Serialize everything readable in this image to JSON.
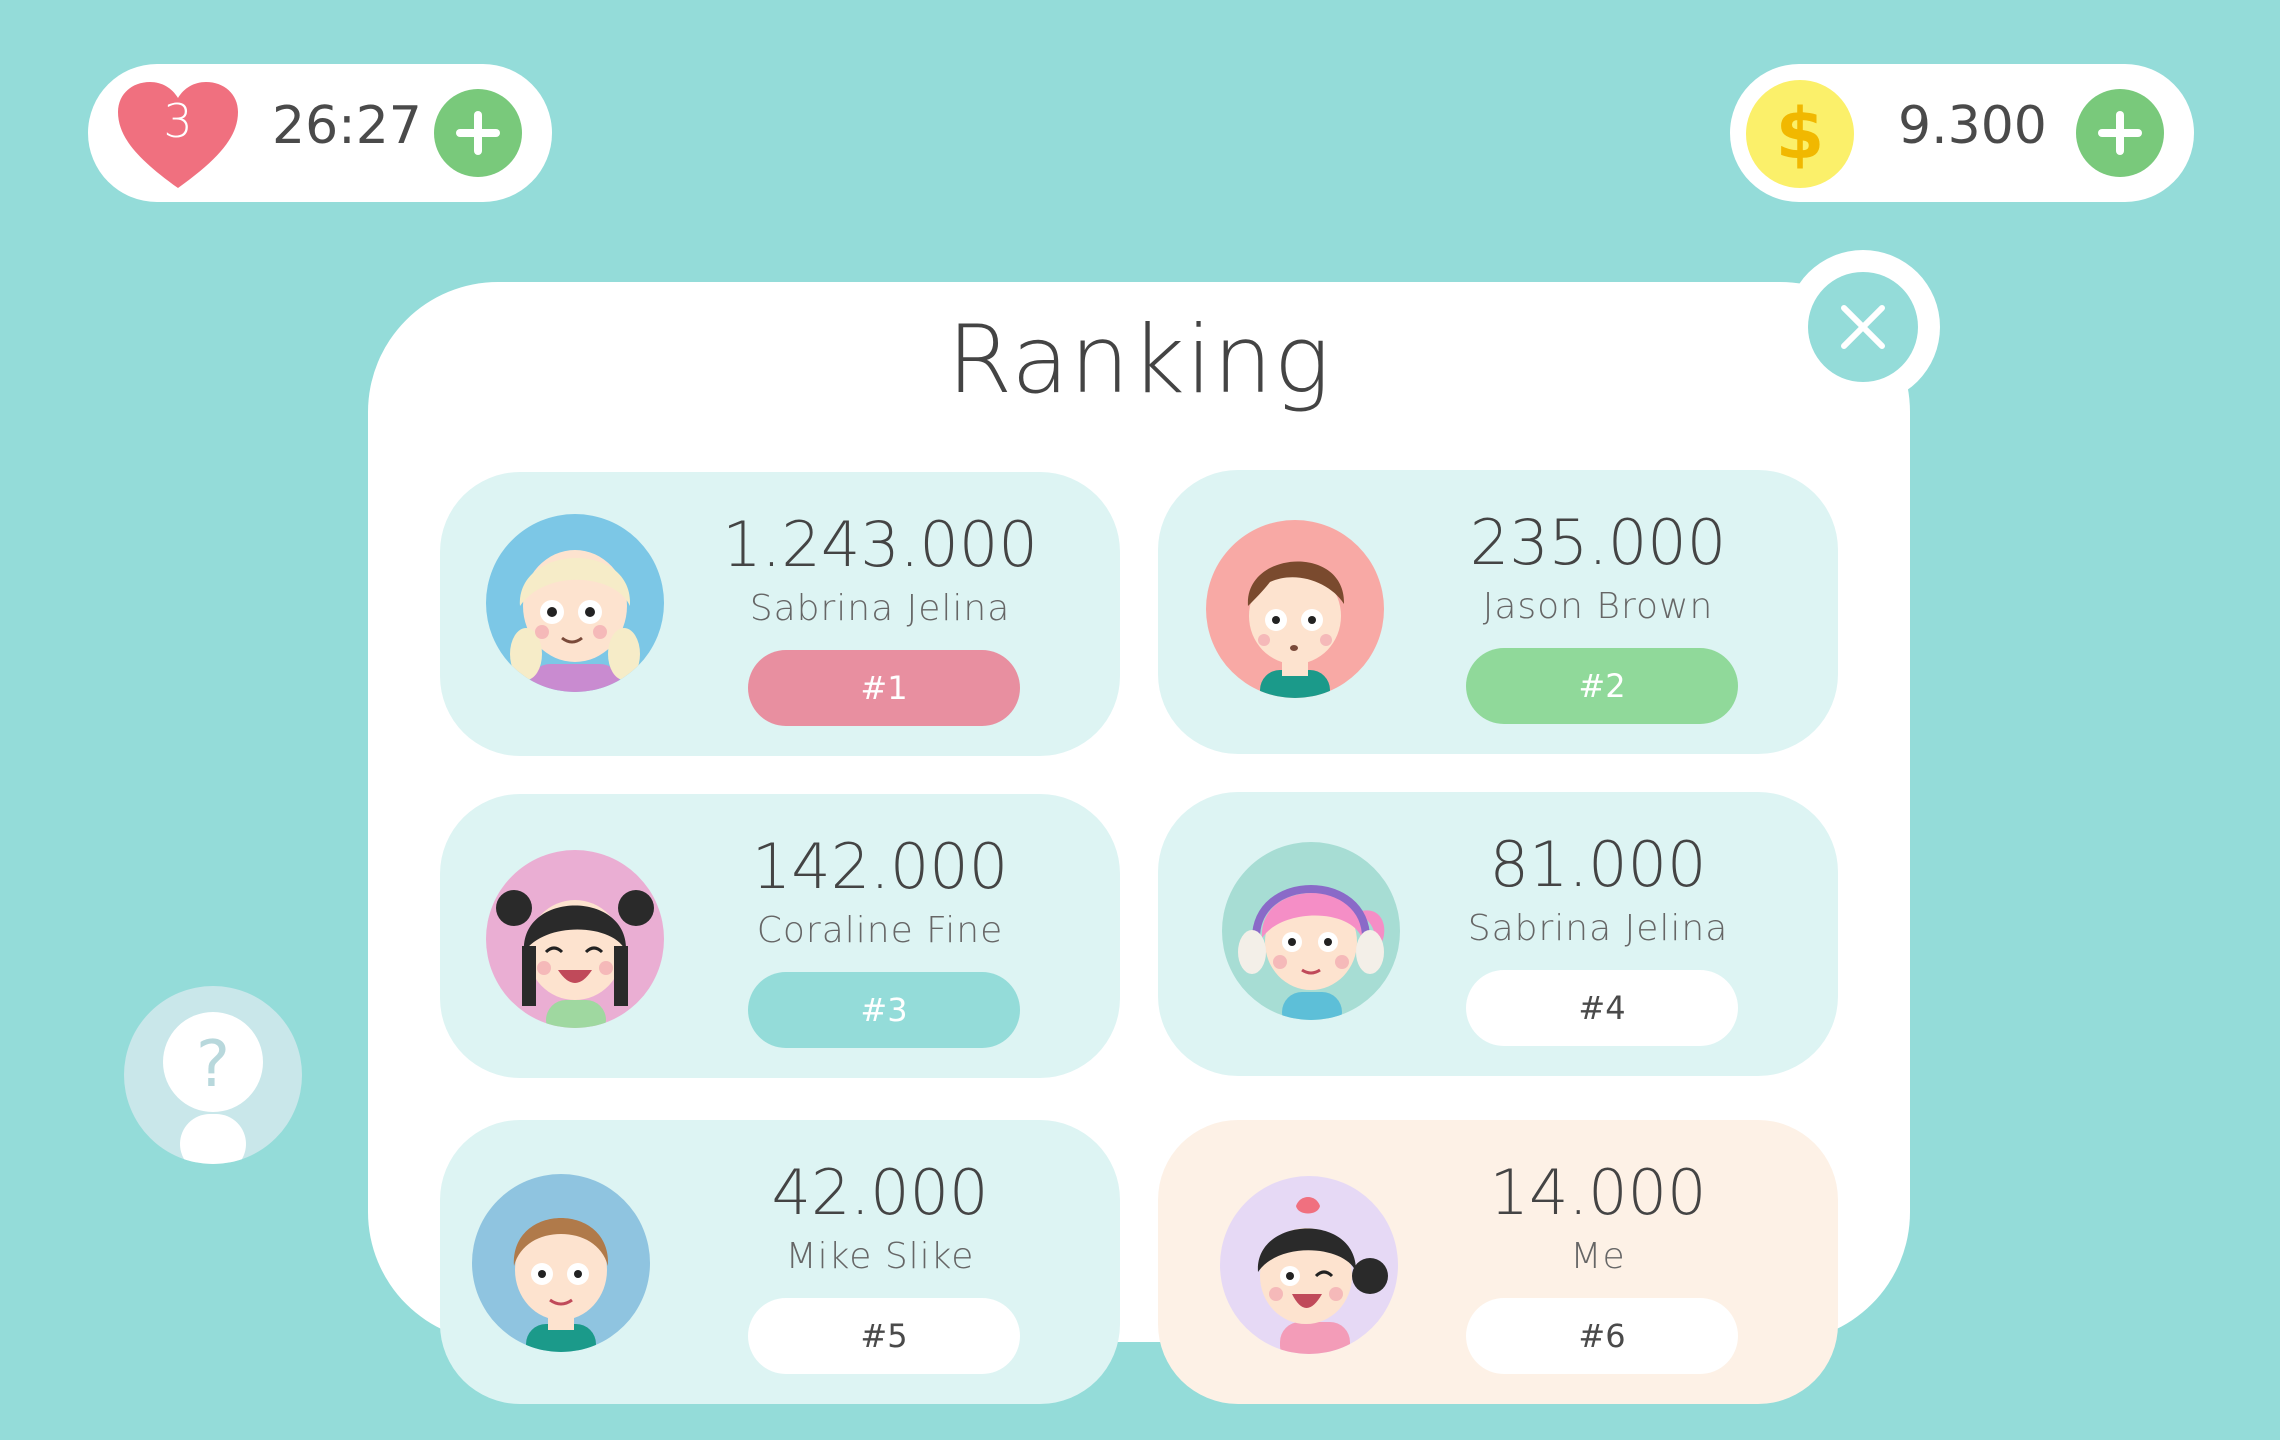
{
  "hud": {
    "lives": "3",
    "timer": "26:27",
    "coins": "9.300",
    "coin_symbol": "$"
  },
  "modal": {
    "title": "Ranking"
  },
  "ranking": [
    {
      "score": "1.243.000",
      "name": "Sabrina Jelina",
      "rank": "#1",
      "avatar": "blonde-girl-avatar"
    },
    {
      "score": "235.000",
      "name": "Jason Brown",
      "rank": "#2",
      "avatar": "brown-hair-boy-avatar"
    },
    {
      "score": "142.000",
      "name": "Coraline Fine",
      "rank": "#3",
      "avatar": "black-bun-girl-avatar"
    },
    {
      "score": "81.000",
      "name": "Sabrina Jelina",
      "rank": "#4",
      "avatar": "pink-hair-headphones-girl-avatar"
    },
    {
      "score": "42.000",
      "name": "Mike Slike",
      "rank": "#5",
      "avatar": "brown-hair-boy-blue-avatar"
    },
    {
      "score": "14.000",
      "name": "Me",
      "rank": "#6",
      "avatar": "strawberry-girl-avatar"
    }
  ],
  "help": {
    "symbol": "?"
  },
  "colors": {
    "background": "#94dcd9",
    "rank1": "#e88fa0",
    "rank2": "#90d99a",
    "rank3": "#94dcd9",
    "plus": "#79c97b",
    "heart": "#f0707f",
    "coin": "#fbf06a"
  }
}
